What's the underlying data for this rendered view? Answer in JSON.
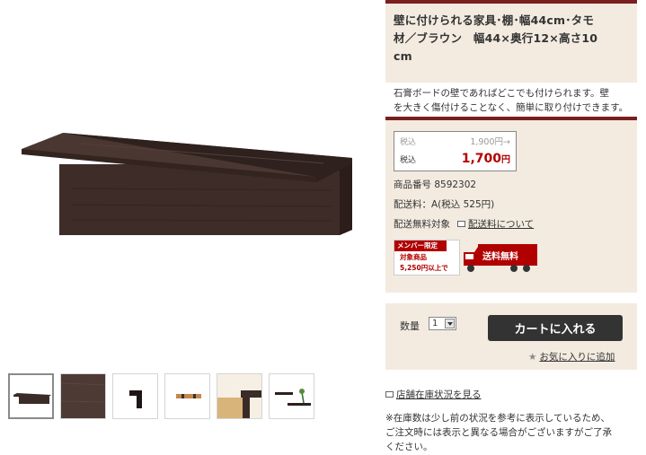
{
  "product": {
    "title": "壁に付けられる家具･棚･幅44cm･タモ材／ブラウン　幅44×奥行12×高さ10cm",
    "title_lines": [
      "壁に付けられる家具･棚･幅44cm･タモ",
      "材／ブラウン　幅44×奥行12×高さ10",
      "cm"
    ],
    "description_lines": [
      "石膏ボードの壁であればどこでも付けられます。壁",
      "を大きく傷付けることなく、簡単に取り付けできます。"
    ]
  },
  "price": {
    "old_label": "税込",
    "old_value": "1,900円→",
    "new_label": "税込",
    "new_value": "1,700",
    "new_unit": "円"
  },
  "info": {
    "product_number": "商品番号  8592302",
    "shipping_fee": "配送料：A(税込  525円)",
    "free_shipping_label": "配送無料対象",
    "shipping_link": "配送料について"
  },
  "member_banner": {
    "tag": "メンバー限定",
    "line1": "対象商品",
    "line2": "5,250円以上で",
    "badge": "送料無料"
  },
  "cart": {
    "qty_label": "数量",
    "qty_value": "1",
    "add_to_cart": "カートに入れる",
    "favorite": "お気に入りに追加",
    "favorite_icon": "star-icon"
  },
  "store_stock_link": "店舗在庫状況を見る",
  "stock_note_lines": [
    "※在庫数は少し前の状況を参考に表示しているため、",
    "ご注文時には表示と異なる場合がございますがご了承",
    "ください。"
  ],
  "thumbnails": [
    {
      "name": "thumb-shelf-front",
      "active": true
    },
    {
      "name": "thumb-wood-texture",
      "active": false
    },
    {
      "name": "thumb-shelf-side",
      "active": false
    },
    {
      "name": "thumb-shelf-top",
      "active": false
    },
    {
      "name": "thumb-shelf-in-room",
      "active": false
    },
    {
      "name": "thumb-shelves-with-plant",
      "active": false
    }
  ],
  "colors": {
    "accent_dark_red": "#7a1e1e",
    "price_red": "#b10000",
    "panel_beige": "#f3ebe0",
    "button_dark": "#333333",
    "wood_brown": "#3a2b27"
  }
}
